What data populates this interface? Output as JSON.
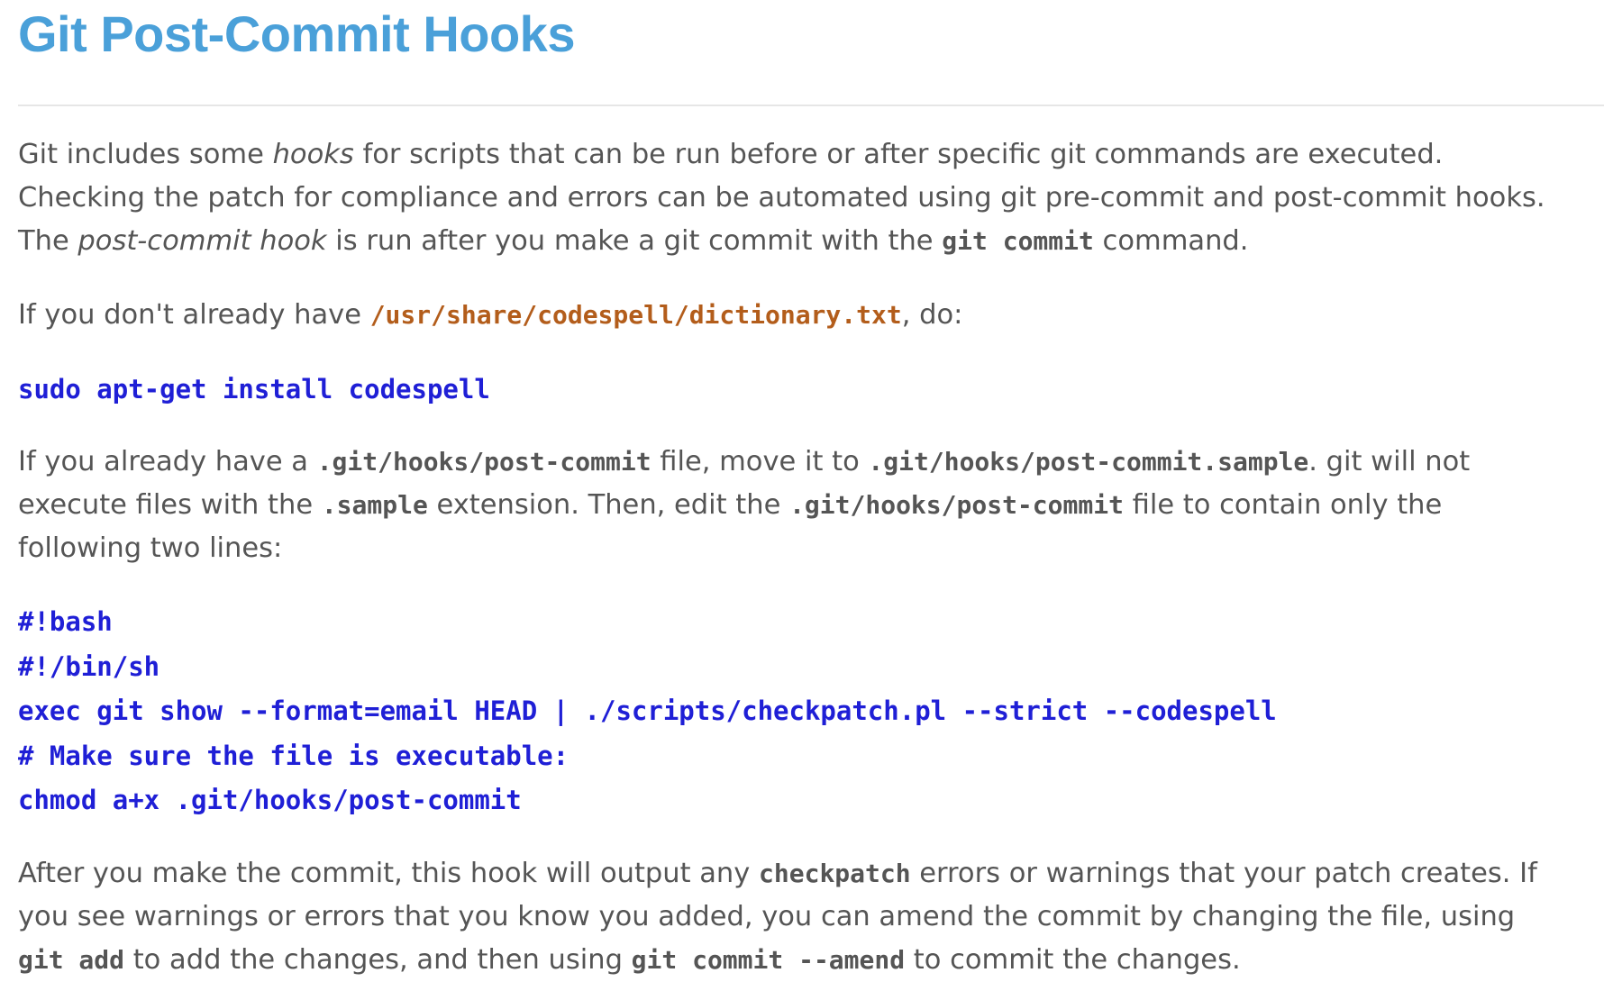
{
  "title": "Git Post-Commit Hooks",
  "para1": {
    "l1_a": "Git includes some ",
    "l1_em": "hooks",
    "l1_b": " for scripts that can be run before or after specific git commands are executed.",
    "l2": "Checking the patch for compliance and errors can be automated using git pre-commit and post-commit hooks.",
    "l3_a": "The ",
    "l3_em": "post-commit hook",
    "l3_b": " is run after you make a git commit with the ",
    "l3_code": "git commit",
    "l3_c": " command."
  },
  "para2": {
    "a": "If you don't already have ",
    "path": "/usr/share/codespell/dictionary.txt",
    "b": ", do:"
  },
  "install_cmd": "sudo apt-get install codespell",
  "para3": {
    "l1_a": "If you already have a ",
    "l1_code1": ".git/hooks/post-commit",
    "l1_b": " file, move it to ",
    "l1_code2": ".git/hooks/post-commit.sample",
    "l1_c": ". git will not",
    "l2_a": "execute files with the ",
    "l2_code1": ".sample",
    "l2_b": " extension. Then, edit the ",
    "l2_code2": ".git/hooks/post-commit",
    "l2_c": " file to contain only the",
    "l3": "following two lines:"
  },
  "script_lines": [
    "#!bash",
    "#!/bin/sh",
    "exec git show --format=email HEAD | ./scripts/checkpatch.pl --strict --codespell",
    "# Make sure the file is executable:",
    "chmod a+x .git/hooks/post-commit"
  ],
  "para4": {
    "l1_a": "After you make the commit, this hook will output any ",
    "l1_code": "checkpatch",
    "l1_b": " errors or warnings that your patch creates. If",
    "l2": "you see warnings or errors that you know you added, you can amend the commit by changing the file, using",
    "l3_code1": "git add",
    "l3_a": " to add the changes, and then using ",
    "l3_code2": "git commit --amend",
    "l3_b": " to commit the changes."
  }
}
